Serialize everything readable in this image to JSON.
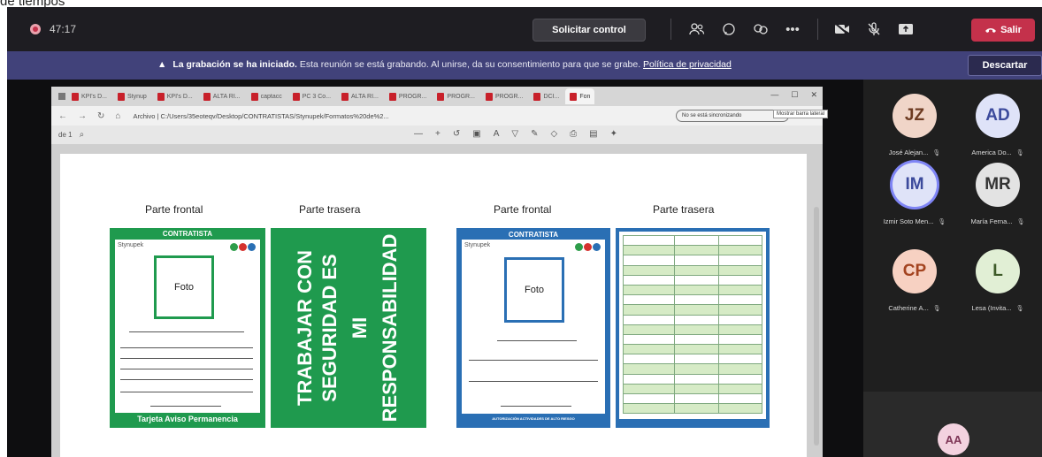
{
  "page_fragment": "de tiempos",
  "meeting": {
    "timer": "47:17",
    "request_control": "Solicitar control",
    "leave": "Salir",
    "icons": [
      "people-icon",
      "chat-icon",
      "react-icon",
      "more-icon",
      "camera-off-icon",
      "mic-off-icon",
      "share-icon",
      "phone-icon"
    ]
  },
  "banner": {
    "bold": "La grabación se ha iniciado.",
    "text": "Esta reunión se está grabando. Al unirse, da su consentimiento para que se grabe.",
    "link": "Política de privacidad",
    "dismiss": "Descartar"
  },
  "browser": {
    "tabs": [
      "KPI's D...",
      "Stynup",
      "KPI's D...",
      "ALTA RI...",
      "captacc",
      "PC 3 Co...",
      "ALTA RI...",
      "PROGR...",
      "PROGR...",
      "PROGR...",
      "DCI...",
      "Fon"
    ],
    "url": "Archivo  |  C:/Users/35eoteqv/Desktop/CONTRATISTAS/Stynupek/Formatos%20de%2...",
    "pill": "No se está sincronizando",
    "tooltip": "Mostrar barra lateral",
    "page_num": "de 1",
    "window_controls": [
      "—",
      "☐",
      "✕"
    ]
  },
  "document": {
    "label_front_1": "Parte frontal",
    "label_back_1": "Parte trasera",
    "label_front_2": "Parte frontal",
    "label_back_2": "Parte trasera",
    "green_card": {
      "header": "CONTRATISTA",
      "brand": "Stynupek",
      "photo": "Foto",
      "footer": "Tarjeta Aviso Permanencia",
      "back_text_1": "TRABAJAR CON",
      "back_text_2": "SEGURIDAD ES",
      "back_text_3": "MI",
      "back_text_4": "RESPONSABILIDAD"
    },
    "blue_card": {
      "header": "CONTRATISTA",
      "brand": "Stynupek",
      "photo": "Foto",
      "footer": "AUTORIZACIÓN ACTIVIDADES DE ALTO RIESGO"
    }
  },
  "participants": [
    {
      "initials": "JZ",
      "name": "José Alejan...",
      "bg": "#f0d5c8",
      "fg": "#6d3b22"
    },
    {
      "initials": "AD",
      "name": "America Do...",
      "bg": "#dfe3f8",
      "fg": "#3c4a9c"
    },
    {
      "initials": "IM",
      "name": "Izmir Soto Men...",
      "bg": "#dfe3f8",
      "fg": "#3c4a9c"
    },
    {
      "initials": "MR",
      "name": "María Ferna...",
      "bg": "#e3e3e3",
      "fg": "#333333"
    },
    {
      "initials": "CP",
      "name": "Catherine A...",
      "bg": "#f7d1c2",
      "fg": "#a3431f"
    },
    {
      "initials": "L",
      "name": "Lesa (Invita...",
      "bg": "#e1efd5",
      "fg": "#3d5a28"
    }
  ],
  "self_initials": "AA",
  "colors": {
    "teams_bar": "#1e1d22",
    "banner": "#41427a",
    "leave": "#c4314b",
    "card_green": "#1f9a4e",
    "card_blue": "#2a6fb4"
  }
}
